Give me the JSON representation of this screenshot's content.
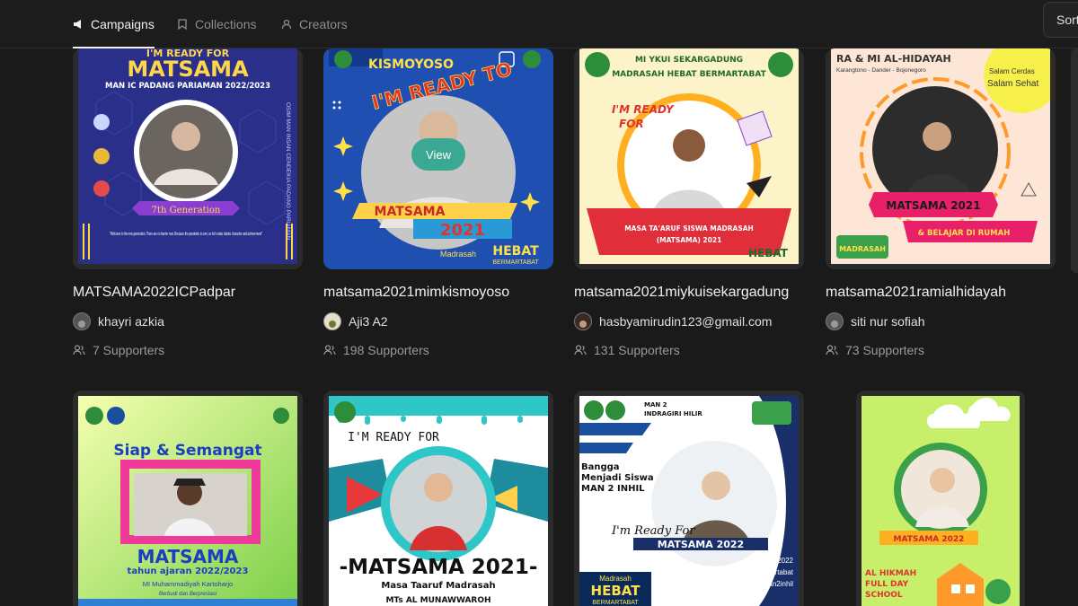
{
  "nav": {
    "tabs": [
      {
        "label": "Campaigns",
        "icon": "megaphone-icon",
        "active": true
      },
      {
        "label": "Collections",
        "icon": "bookmark-icon",
        "active": false
      },
      {
        "label": "Creators",
        "icon": "user-icon",
        "active": false
      }
    ],
    "sort_label": "Sort"
  },
  "campaigns": [
    {
      "title": "MATSAMA2022ICPadpar",
      "author": "khayri azkia",
      "supporters": "7 Supporters",
      "poster": {
        "line1": "I'M READY FOR",
        "line2": "MATSAMA",
        "line3": "MAN IC PADANG PARIAMAN 2022/2023",
        "ribbon": "7th Generation",
        "quote": "\"Welcome to the new generation. There are no barrier now. Because the pandemic is over, so let's make islamic character and achievement\"",
        "side": "OSIM MAN INSAN CENDEKIA PADANG PARIAMAN"
      }
    },
    {
      "title": "matsama2021mimkismoyoso",
      "author": "Aji3 A2",
      "supporters": "198 Supporters",
      "view_label": "View",
      "poster": {
        "line1": "KISMOYOSO",
        "line2": "I'M READY TO",
        "line3": "MATSAMA",
        "line4": "2021",
        "line5": "Madrasah",
        "line6": "HEBAT",
        "line7": "BERMARTABAT"
      }
    },
    {
      "title": "matsama2021miykuisekargadung",
      "author": "hasbyamirudin123@gmail.com",
      "supporters": "131 Supporters",
      "poster": {
        "line1": "MI YKUI SEKARGADUNG",
        "line2": "MADRASAH HEBAT BERMARTABAT",
        "line3": "I'M READY",
        "line4": "FOR",
        "line5": "MASA TA'ARUF SISWA MADRASAH",
        "line6": "(MATSAMA) 2021",
        "line7": "HEBAT"
      }
    },
    {
      "title": "matsama2021ramialhidayah",
      "author": "siti nur sofiah",
      "supporters": "73 Supporters",
      "poster": {
        "line1": "RA & MI AL-HIDAYAH",
        "line2": "Karangtono - Dander - Bojonegoro",
        "line3": "Salam Cerdas",
        "line4": "Salam Sehat",
        "line5": "MATSAMA 2021",
        "line6": "& BELAJAR DI RUMAH",
        "line7": "MADRASAH"
      }
    },
    {
      "poster": {
        "line1": "Siap & Semangat",
        "line2": "MATSAMA",
        "line3": "tahun ajaran 2022/2023",
        "line4": "MI Muhammadiyah Kartoharjo",
        "line5": "Berbudi dan Berprestasi"
      }
    },
    {
      "poster": {
        "line1": "I'M READY FOR",
        "line2": "-MATSAMA 2021-",
        "line3": "Masa Taaruf Madrasah",
        "line4": "MTs AL MUNAWWAROH"
      }
    },
    {
      "poster": {
        "line1": "MAN 2",
        "line2": "INDRAGIRI HILIR",
        "line3": "Bangga",
        "line4": "Menjadi Siswa",
        "line5": "MAN 2 INHIL",
        "line6": "I'm Ready For",
        "line7": "MATSAMA 2022",
        "tags": [
          "#matsama2022",
          "#madrasahhebatbermartabat",
          "#osimman2inhil"
        ],
        "line8": "Madrasah",
        "line9": "HEBAT",
        "line10": "BERMARTABAT"
      }
    },
    {
      "poster": {
        "line1": "MATSAMA 2022",
        "line2": "AL HIKMAH",
        "line3": "FULL DAY",
        "line4": "SCHOOL"
      }
    }
  ],
  "colors": {
    "background": "#1a1a1a",
    "card": "#2b2b2b",
    "view_button": "#3aa892"
  }
}
